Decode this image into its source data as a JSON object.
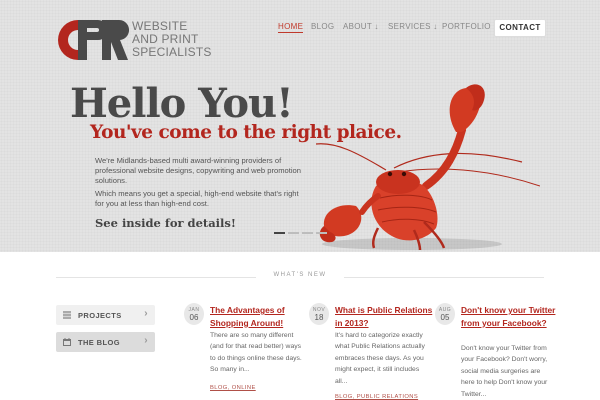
{
  "logo": {
    "line1": "WEBSITE",
    "line2": "AND PRINT",
    "line3": "SPECIALISTS"
  },
  "nav": {
    "items": [
      {
        "label": "HOME",
        "active": true
      },
      {
        "label": "BLOG"
      },
      {
        "label": "ABOUT ↓"
      },
      {
        "label": "SERVICES ↓"
      },
      {
        "label": "PORTFOLIO"
      }
    ],
    "contact": "CONTACT"
  },
  "hero": {
    "title": "Hello You!",
    "subtitle": "You've come to the right plaice.",
    "para1": "We're Midlands-based multi award-winning providers of professional website designs, copywriting and web promotion solutions.",
    "para2": "Which means you get a special, high-end website that's right for you at less than high-end cost.",
    "cta": "See inside for details!",
    "slides_total": 4,
    "slide_active": 1
  },
  "whats_new": "WHAT'S NEW",
  "sidebar": {
    "projects": "PROJECTS",
    "blog": "THE BLOG"
  },
  "posts": [
    {
      "month": "JAN",
      "day": "06",
      "title": "The Advantages of Shopping Around!",
      "excerpt": "There are so many different (and for that read better) ways to do things online these days. So many in...",
      "tags": "BLOG, ONLINE"
    },
    {
      "month": "NOV",
      "day": "18",
      "title": "What is Public Relations in 2013?",
      "excerpt": "It's hard to categorize exactly what Public Relations actually embraces these days. As you might expect, it still includes all...",
      "tags": "BLOG, PUBLIC RELATIONS"
    },
    {
      "month": "AUG",
      "day": "05",
      "title": "Don't know your Twitter from your Facebook?",
      "excerpt": "Don't know your Twitter from your Facebook? Don't worry, social media surgeries are here to help Don't know your Twitter..."
    }
  ],
  "colors": {
    "accent": "#b3261e",
    "hero_bg": "#e3e3e3",
    "heading": "#4a4a4a"
  }
}
